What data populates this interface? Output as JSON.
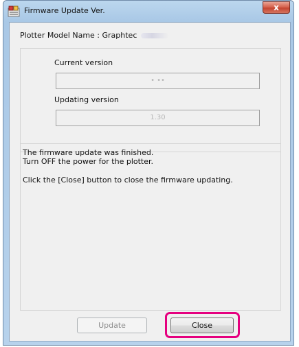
{
  "window": {
    "title": "Firmware Update Ver.",
    "close_glyph": "x"
  },
  "model": {
    "label": "Plotter Model Name : Graphtec"
  },
  "versions": {
    "current_label": "Current version",
    "current_value": "• ••",
    "updating_label": "Updating version",
    "updating_value": "1.30"
  },
  "message": {
    "line1": "The firmware update was finished.",
    "line2": "Turn OFF the power for the plotter.",
    "line3": "Click the [Close] button to close the firmware updating."
  },
  "buttons": {
    "update_label": "Update",
    "close_label": "Close"
  },
  "colors": {
    "highlight": "#e5007f",
    "window_frame": "#a9c8e6"
  },
  "icons": {
    "app": "firmware-app-icon"
  }
}
